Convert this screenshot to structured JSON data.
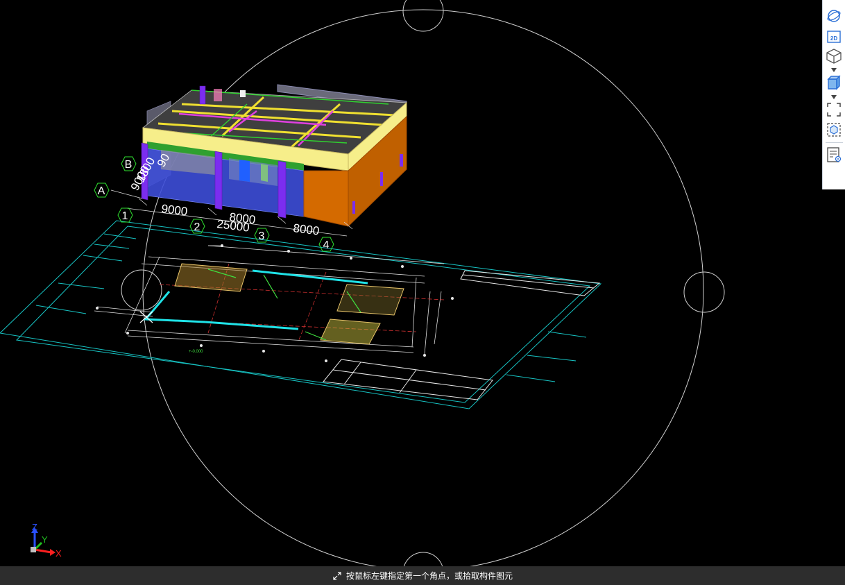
{
  "viewport": {
    "dimension_labels": {
      "d1": "9000",
      "d2": "25000",
      "d2b": "8000",
      "d3": "8000"
    },
    "axis_bubbles": {
      "a": "A",
      "b": "B",
      "n1": "1",
      "n2": "2",
      "n3": "3",
      "n4": "4"
    },
    "rotated_dims": {
      "r1": "9000",
      "r2": "1800",
      "r3": "90"
    },
    "colors": {
      "drawing_frame": "#17c3c3",
      "circle": "#cfcfcf",
      "wall": "#d46a00",
      "beam_top": "#f6ee8a",
      "column": "#7b2df0"
    }
  },
  "coordinate_axes": {
    "x": "X",
    "y": "Y",
    "z": "Z"
  },
  "toolbar": {
    "icons": [
      "orbit-icon",
      "2d-view-icon",
      "3d-view-icon",
      "solid-box-icon",
      "fit-view-icon",
      "zoom-selection-icon",
      "properties-panel-icon"
    ],
    "label_2d": "2D"
  },
  "status_bar": {
    "icon": "cursor-pick-icon",
    "prompt": "按鼠标左键指定第一个角点，或拾取构件图元"
  }
}
